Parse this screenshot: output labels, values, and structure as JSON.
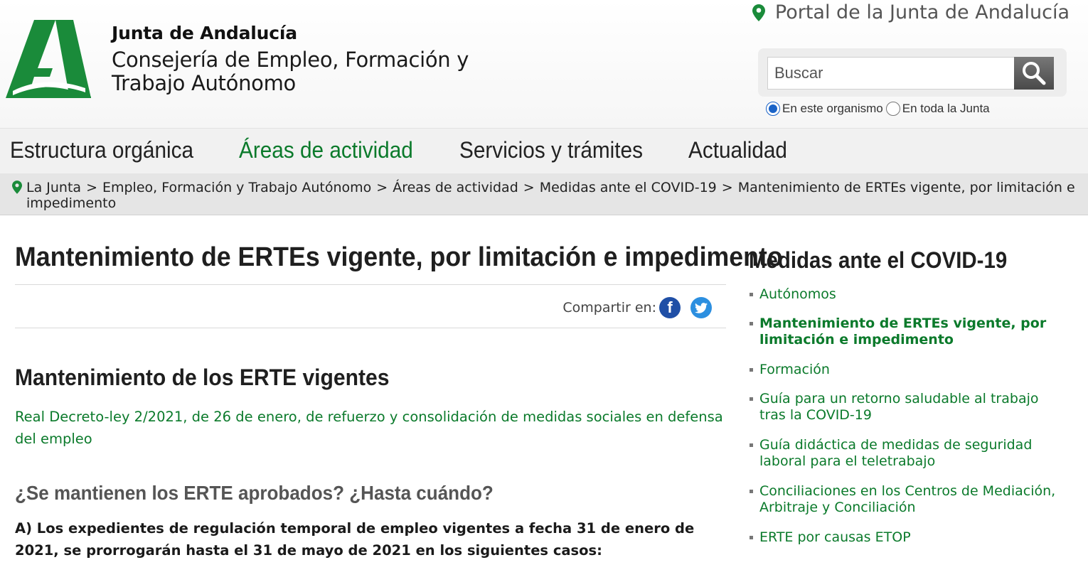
{
  "header": {
    "org_name": "Junta de Andalucía",
    "department": "Consejería de Empleo, Formación y Trabajo Autónomo",
    "portal_link": "Portal de la Junta de Andalucía",
    "brand_color": "#1a8b3a"
  },
  "search": {
    "placeholder": "Buscar",
    "value": "",
    "scope_options": [
      "En este organismo",
      "En toda la Junta"
    ],
    "selected_scope": "En este organismo"
  },
  "nav": {
    "items": [
      "Estructura orgánica",
      "Áreas de actividad",
      "Servicios y trámites",
      "Actualidad"
    ],
    "active": "Áreas de actividad"
  },
  "breadcrumb": {
    "items": [
      "La Junta",
      "Empleo, Formación y Trabajo Autónomo",
      "Áreas de actividad",
      "Medidas ante el COVID-19",
      "Mantenimiento de ERTEs vigente, por limitación e impedimento"
    ],
    "separator": ">"
  },
  "main": {
    "title": "Mantenimiento de ERTEs vigente, por limitación e impedimento",
    "share_label": "Compartir en:",
    "section_title": "Mantenimiento de los ERTE vigentes",
    "decree_link": "Real Decreto-ley 2/2021, de 26 de enero, de refuerzo y consolidación de medidas sociales en defensa del empleo",
    "question": "¿Se mantienen los ERTE aprobados? ¿Hasta cuándo?",
    "bold_paragraph": "A) Los expedientes de regulación temporal de empleo vigentes a fecha 31 de enero de 2021, se prorrogarán hasta el 31 de mayo de 2021 en los siguientes casos:"
  },
  "sidebar": {
    "title": "Medidas ante el COVID-19",
    "items": [
      "Autónomos",
      "Mantenimiento de ERTEs vigente, por limitación e impedimento",
      "Formación",
      "Guía para un retorno saludable al trabajo tras la COVID-19",
      "Guía didáctica de medidas de seguridad laboral para el teletrabajo",
      "Conciliaciones en los Centros de Mediación, Arbitraje y Conciliación",
      "ERTE por causas ETOP"
    ],
    "current_index": 1
  },
  "colors": {
    "link_green": "#0b7a2b",
    "nav_background": "#f1f1f1",
    "breadcrumb_background": "#e5e5e5"
  }
}
